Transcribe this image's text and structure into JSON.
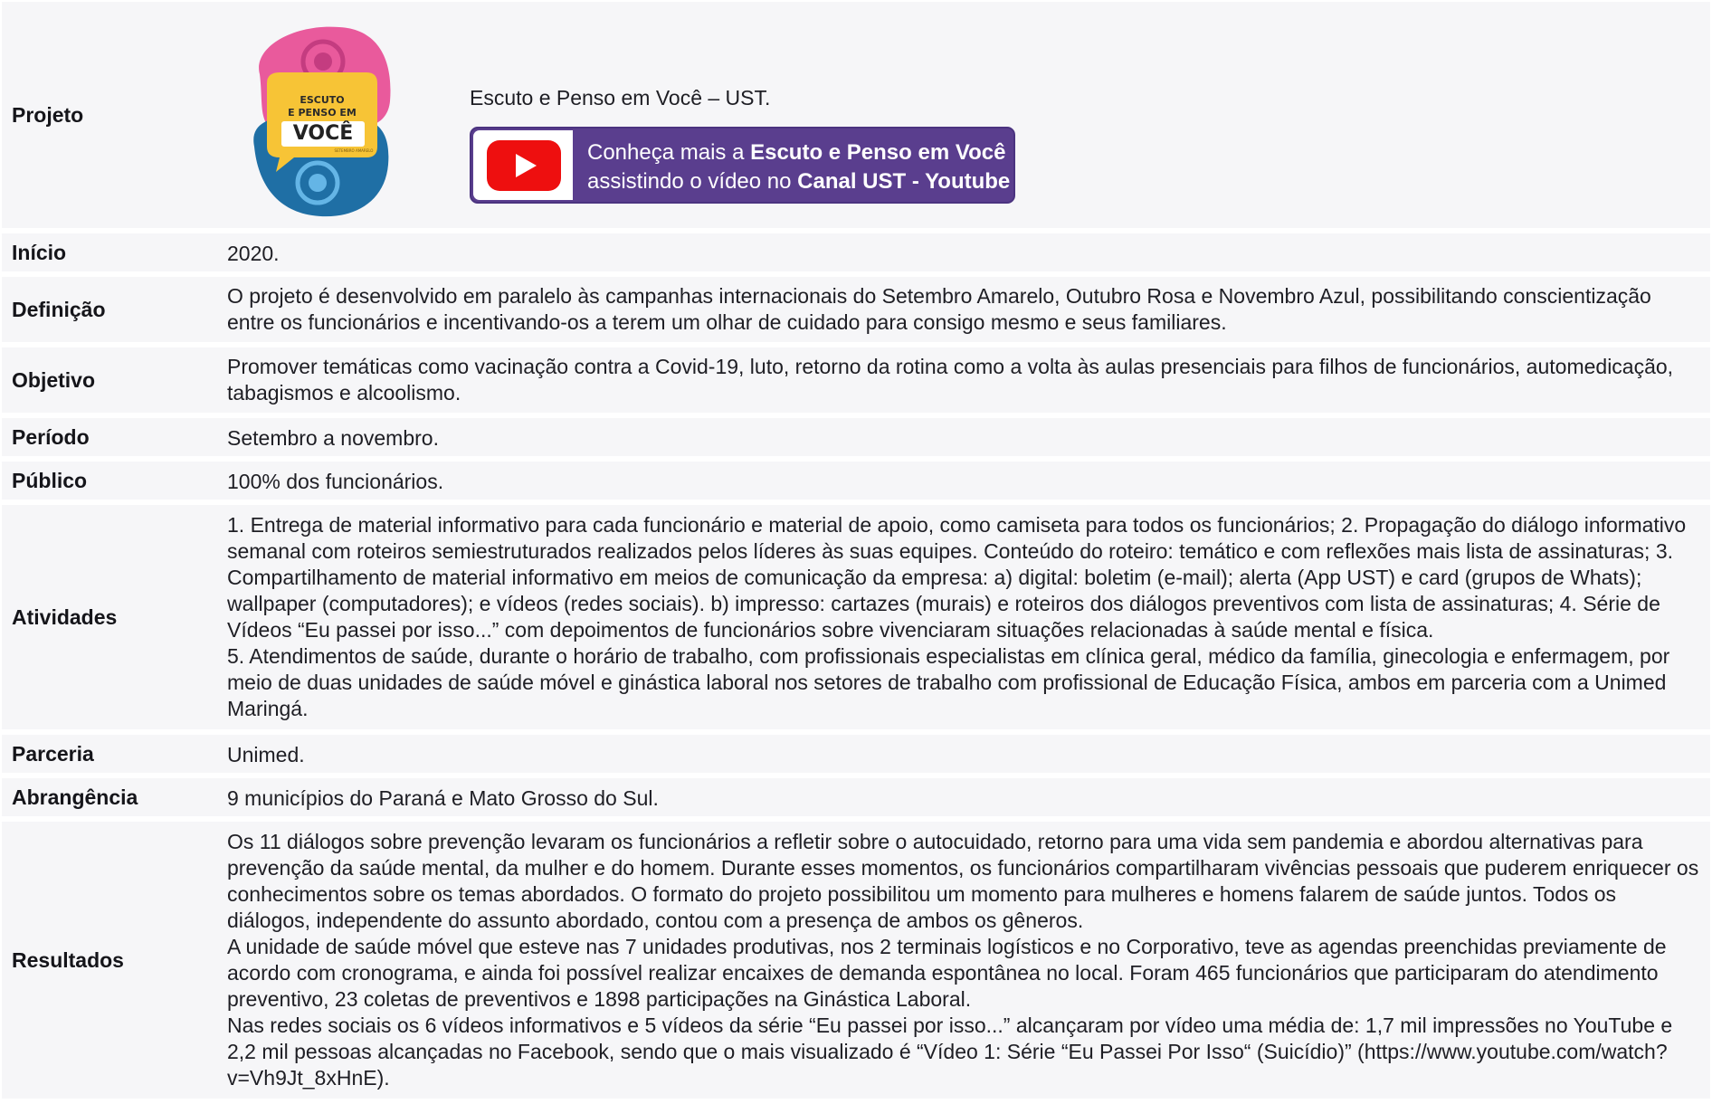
{
  "rows": {
    "projeto": {
      "label": "Projeto",
      "logo_text": {
        "line1": "ESCUTO",
        "line2": "E PENSO EM",
        "line3": "VOCÊ",
        "line4": "SETEMBRO AMARELO"
      },
      "project_name": "Escuto e Penso em Você – UST.",
      "youtube": {
        "prefix1": "Conheça mais a ",
        "bold1": "Escuto e Penso em Você",
        "prefix2": "assistindo o vídeo no ",
        "bold2": "Canal UST - Youtube"
      }
    },
    "inicio": {
      "label": "Início",
      "value": "2020."
    },
    "definicao": {
      "label": "Definição",
      "value": "O projeto é desenvolvido em paralelo às campanhas internacionais do Setembro Amarelo, Outubro Rosa e Novembro Azul, possibilitando conscientização entre os funcionários e incentivando-os a terem um olhar de cuidado para consigo mesmo e seus familiares."
    },
    "objetivo": {
      "label": "Objetivo",
      "value": "Promover temáticas como vacinação contra a Covid-19, luto, retorno da rotina como a volta às aulas presenciais para filhos de funcionários, automedicação, tabagismos e alcoolismo."
    },
    "periodo": {
      "label": "Período",
      "value": "Setembro a novembro."
    },
    "publico": {
      "label": "Público",
      "value": "100% dos funcionários."
    },
    "atividades": {
      "label": "Atividades",
      "p1": "1. Entrega de material informativo para cada funcionário e material de apoio, como camiseta para todos os funcionários; 2. Propagação do diálogo informativo semanal com roteiros semiestruturados realizados pelos líderes às suas equipes. Conteúdo do roteiro: temático e com reflexões mais lista de assinaturas; 3. Compartilhamento de material informativo em meios de comunicação da empresa: a) digital: boletim (e-mail); alerta (App UST) e card (grupos de Whats); wallpaper (computadores); e vídeos (redes sociais). b) impresso: cartazes (murais) e roteiros dos diálogos preventivos com lista de assinaturas; 4. Série de Vídeos “Eu passei por isso...” com depoimentos de funcionários sobre vivenciaram situações relacionadas à saúde mental e física.",
      "p2": "5. Atendimentos de saúde, durante o horário de trabalho, com profissionais especialistas em clínica geral, médico da família, ginecologia e enfermagem, por meio de duas unidades de saúde móvel e ginástica laboral nos setores de trabalho com profissional de Educação Física, ambos em parceria com a Unimed Maringá."
    },
    "parceria": {
      "label": "Parceria",
      "value": "Unimed."
    },
    "abrangencia": {
      "label": "Abrangência",
      "value": "9 municípios do Paraná e Mato Grosso do Sul."
    },
    "resultados": {
      "label": "Resultados",
      "p1": "Os 11 diálogos sobre prevenção levaram os funcionários a refletir sobre o autocuidado, retorno para uma vida sem pandemia e abordou alternativas para prevenção da saúde mental, da mulher e do homem. Durante esses momentos, os funcionários compartilharam vivências pessoais que puderem enriquecer os conhecimentos sobre os temas abordados. O formato do projeto possibilitou um momento para mulheres e homens falarem de saúde juntos. Todos os diálogos, independente do assunto abordado, contou com a presença de ambos os gêneros.",
      "p2": "A unidade de saúde móvel que esteve nas 7 unidades produtivas, nos 2 terminais logísticos e no Corporativo, teve as agendas preenchidas previamente de acordo com cronograma, e ainda foi possível realizar encaixes de demanda espontânea no local. Foram 465 funcionários que participaram do atendimento preventivo, 23 coletas de preventivos e 1898 participações na Ginástica Laboral.",
      "p3": "Nas redes sociais os 6 vídeos informativos e 5 vídeos da série “Eu passei por isso...” alcançaram por vídeo uma média de: 1,7 mil impressões no YouTube e 2,2 mil pessoas alcançadas no Facebook, sendo que o mais visualizado é “Vídeo 1: Série “Eu Passei Por Isso“ (Suicídio)” (https://www.youtube.com/watch?v=Vh9Jt_8xHnE)."
    }
  },
  "colors": {
    "row_bg": "#f6f6f8",
    "banner_bg": "#5a3e8e",
    "youtube_red": "#ee0f0f",
    "logo_pink": "#e95a9c",
    "logo_blue": "#1f6fa5",
    "logo_yellow": "#f7c436"
  },
  "icons": {
    "logo": "escuto-e-penso-em-voce-logo",
    "youtube": "youtube-play-icon"
  }
}
